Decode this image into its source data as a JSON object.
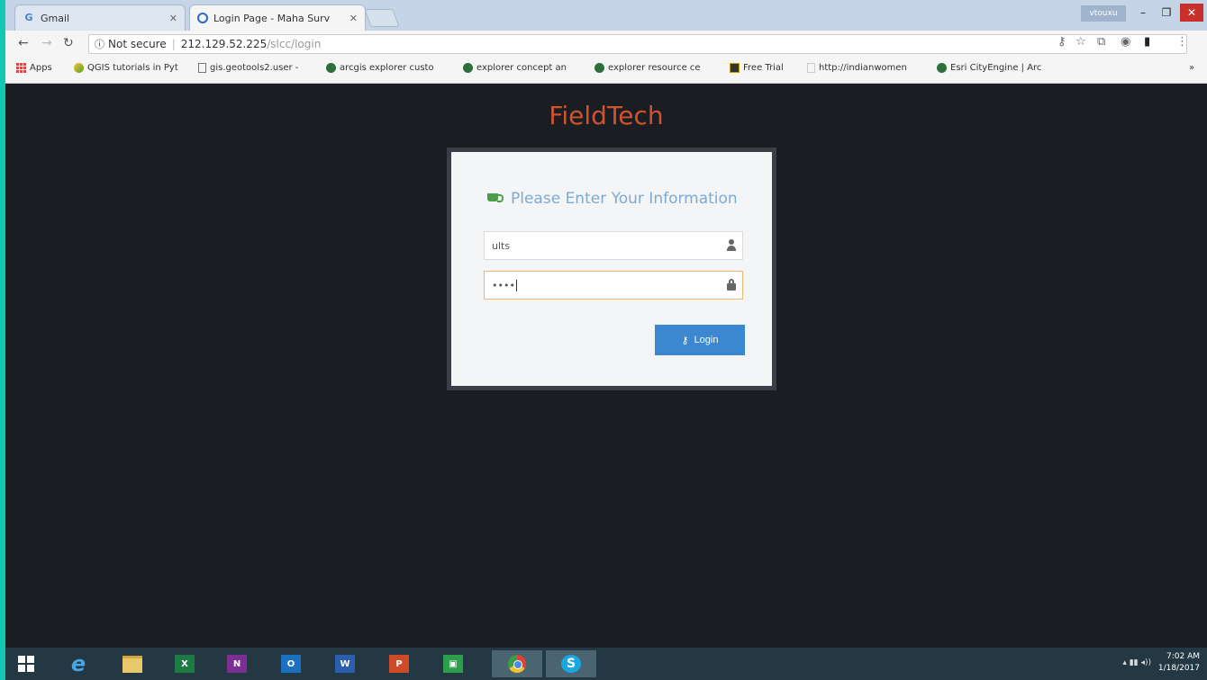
{
  "browser": {
    "tabs": [
      {
        "title": "Gmail",
        "favicon": "gmail-icon"
      },
      {
        "title": "Login Page - Maha Surv",
        "favicon": "globe-icon",
        "active": true
      }
    ],
    "user_chip": "vtouxu",
    "address": {
      "security_label": "Not secure",
      "host": "212.129.52.225",
      "path": "/slcc/login"
    },
    "bookmarks": [
      {
        "label": "Apps",
        "icon": "apps-grid-icon"
      },
      {
        "label": "QGIS tutorials in Pyt",
        "icon": "qgis-icon"
      },
      {
        "label": "gis.geotools2.user - ",
        "icon": "page-icon"
      },
      {
        "label": "arcgis explorer custo",
        "icon": "globe-icon"
      },
      {
        "label": "explorer concept an",
        "icon": "globe-icon"
      },
      {
        "label": "explorer resource ce",
        "icon": "globe-icon"
      },
      {
        "label": "Free Trial",
        "icon": "trial-icon"
      },
      {
        "label": "http://indianwomen",
        "icon": "page-icon"
      },
      {
        "label": "Esri CityEngine | Arc",
        "icon": "globe-icon"
      }
    ],
    "bookmarks_overflow": "»"
  },
  "page": {
    "brand": "FieldTech",
    "form": {
      "heading": "Please Enter Your Information",
      "username_value": "ults",
      "password_value": "••••",
      "login_label": "Login"
    }
  },
  "taskbar": {
    "apps": [
      "start",
      "internet-explorer",
      "file-explorer",
      "excel",
      "onenote",
      "outlook",
      "word",
      "powerpoint",
      "store",
      "chrome",
      "skype"
    ],
    "time": "7:02 AM",
    "date": "1/18/2017"
  },
  "colors": {
    "brand": "#d0532f",
    "heading": "#7fa9d2",
    "login_button": "#3b87d0",
    "page_bg": "#1a1d22"
  }
}
